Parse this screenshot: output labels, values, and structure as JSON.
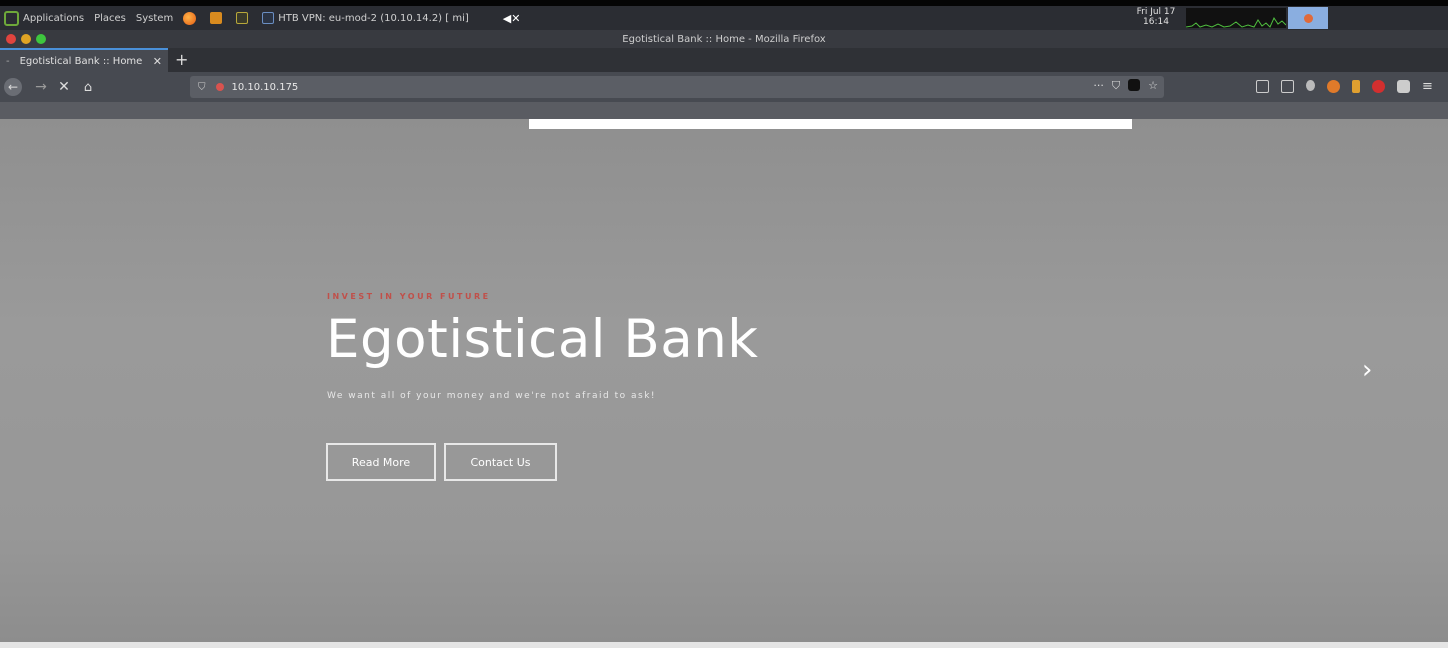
{
  "system_panel": {
    "applications_label": "Applications",
    "places_label": "Places",
    "system_label": "System",
    "vpn_label": "HTB VPN: eu-mod-2 (10.10.14.2) [ mi]",
    "clock_date": "Fri Jul 17",
    "clock_time": "16:14"
  },
  "window": {
    "title": "Egotistical Bank :: Home - Mozilla Firefox"
  },
  "tabs": [
    {
      "label": "Egotistical Bank :: Home"
    }
  ],
  "navigation": {
    "url": "10.10.10.175"
  },
  "hero": {
    "tagline": "INVEST IN YOUR FUTURE",
    "title": "Egotistical Bank",
    "subtitle": "We want all of your money and we're not afraid to ask!",
    "read_more_label": "Read More",
    "contact_us_label": "Contact Us",
    "next_symbol": "›"
  },
  "colors": {
    "accent": "#c0504a",
    "page_background": "#999999"
  },
  "icons": [
    "applications-icon",
    "firefox-icon",
    "terminal-icon",
    "text-editor-icon",
    "vpn-icon",
    "mute-icon",
    "shield-icon",
    "lock-icon",
    "bookmark-star-icon",
    "hamburger-menu-icon"
  ]
}
